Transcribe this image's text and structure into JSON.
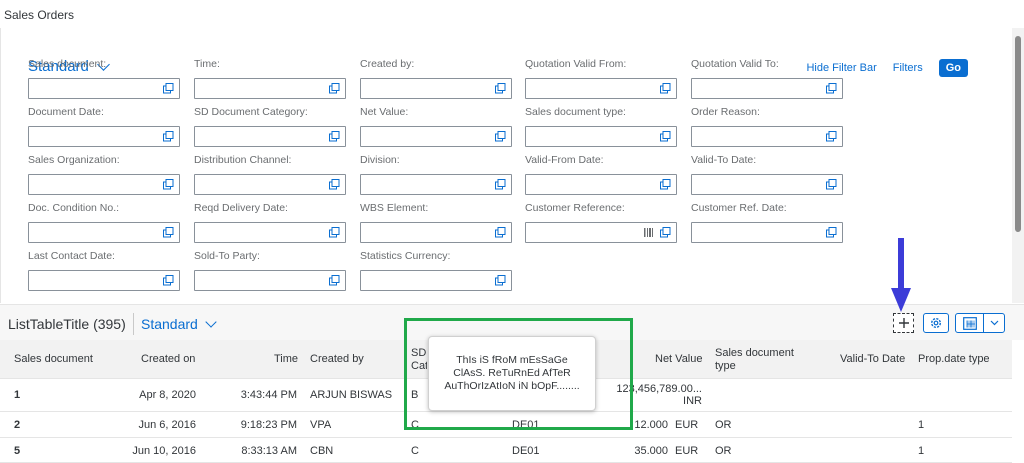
{
  "app": {
    "title": "Sales Orders"
  },
  "filter_bar": {
    "variant": "Standard",
    "hide_filter_bar": "Hide Filter Bar",
    "filters": "Filters",
    "go": "Go",
    "fields": [
      "Sales document:",
      "Time:",
      "Created by:",
      "Quotation Valid From:",
      "Quotation Valid To:",
      "Document Date:",
      "SD Document Category:",
      "Net Value:",
      "Sales document type:",
      "Order Reason:",
      "Sales Organization:",
      "Distribution Channel:",
      "Division:",
      "Valid-From Date:",
      "Valid-To Date:",
      "Doc. Condition No.:",
      "Reqd Delivery Date:",
      "WBS Element:",
      "Customer Reference:",
      "Customer Ref. Date:",
      "Last Contact Date:",
      "Sold-To Party:",
      "Statistics Currency:"
    ]
  },
  "table": {
    "title": "ListTableTitle (395)",
    "variant": "Standard",
    "columns": {
      "sales_document": "Sales document",
      "created_on": "Created on",
      "time": "Time",
      "created_by": "Created by",
      "sd_cat": "SD Cat",
      "net_value": "Net Value",
      "sales_document_type": "Sales document type",
      "valid_to_date": "Valid-To Date",
      "prop_date_type": "Prop.date type"
    },
    "rows": [
      {
        "doc": "1",
        "created_on": "Apr 8, 2020",
        "time": "3:43:44 PM",
        "created_by": "ARJUN BISWAS",
        "sd_cat": "B",
        "col6": "",
        "net_value": "123,456,789.00...",
        "currency": "INR",
        "doc_type": "",
        "valid_to": "",
        "prop": ""
      },
      {
        "doc": "2",
        "created_on": "Jun 6, 2016",
        "time": "9:18:23 PM",
        "created_by": "VPA",
        "sd_cat": "C",
        "col6": "DE01",
        "net_value": "12.000",
        "currency": "EUR",
        "doc_type": "OR",
        "valid_to": "",
        "prop": "1"
      },
      {
        "doc": "5",
        "created_on": "Jun 10, 2016",
        "time": "8:33:13 AM",
        "created_by": "CBN",
        "sd_cat": "C",
        "col6": "DE01",
        "net_value": "35.000",
        "currency": "EUR",
        "doc_type": "OR",
        "valid_to": "",
        "prop": "1"
      }
    ]
  },
  "popup": {
    "message": "ThIs iS fRoM mEsSaGe ClAsS. ReTuRnEd AfTeR AuThOrIzAtIoN iN bOpF........"
  },
  "colors": {
    "accent": "#0a6ed1",
    "annotation_green": "#20a94a",
    "annotation_arrow": "#3c3cd8"
  }
}
